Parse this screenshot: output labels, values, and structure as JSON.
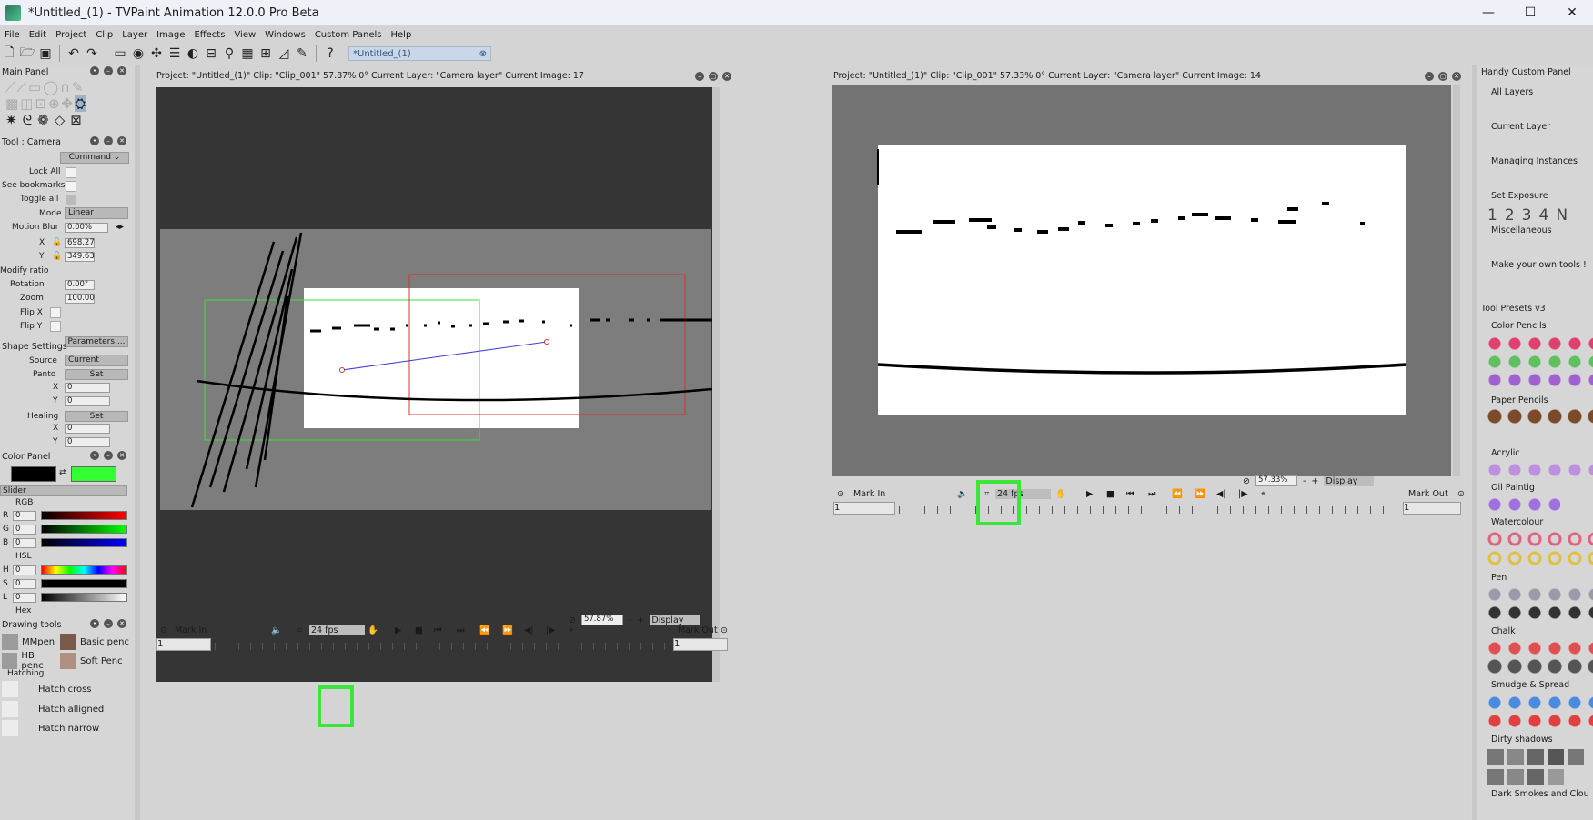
{
  "window": {
    "title": "*Untitled_(1) - TVPaint Animation 12.0.0 Pro Beta",
    "minimize": "—",
    "maximize": "☐",
    "close": "✕"
  },
  "menu": [
    "File",
    "Edit",
    "Project",
    "Clip",
    "Layer",
    "Image",
    "Effects",
    "View",
    "Windows",
    "Custom Panels",
    "Help"
  ],
  "doc_tab": {
    "label": "*Untitled_(1)",
    "close": "⊗"
  },
  "left": {
    "main_panel": "Main Panel",
    "tool_panel": "Tool : Camera",
    "command_label": "Command",
    "lock_all": "Lock All",
    "see_bookmarks": "See bookmarks",
    "toggle_all": "Toggle all",
    "mode_label": "Mode",
    "mode_value": "Linear",
    "motion_blur_label": "Motion Blur",
    "motion_blur_value": "0.00%",
    "x_label": "X",
    "x_value": "698.27",
    "y_label": "Y",
    "y_value": "349.63",
    "modify_ratio": "Modify ratio",
    "rotation_label": "Rotation",
    "rotation_value": "0.00°",
    "zoom_label": "Zoom",
    "zoom_value": "100.00",
    "flip_x": "Flip X",
    "flip_y": "Flip Y",
    "parameters": "Parameters ...",
    "shape_settings": "Shape Settings",
    "source_label": "Source",
    "source_value": "Current",
    "panto_label": "Panto",
    "set_label": "Set",
    "sx_label": "X",
    "sx_value": "0",
    "sy_label": "Y",
    "sy_value": "0",
    "healing_label": "Healing",
    "hx_label": "X",
    "hx_value": "0",
    "hy_label": "Y",
    "hy_value": "0",
    "color_panel": "Color Panel",
    "slider_label": "Slider",
    "rgb_label": "RGB",
    "r_label": "R",
    "r_value": "0",
    "g_label": "G",
    "g_value": "0",
    "b_label": "B",
    "b_value": "0",
    "hsl_label": "HSL",
    "h_label": "H",
    "h_value": "0",
    "s_label": "S",
    "s_value": "0",
    "l_label": "L",
    "l_value": "0",
    "hex_label": "Hex",
    "drawing_tools": "Drawing tools",
    "tools": [
      "MMpen",
      "Basic penc",
      "HB penc",
      "Soft Penc"
    ],
    "hatching": "Hatching",
    "hatch_items": [
      "Hatch cross",
      "Hatch alligned",
      "Hatch narrow"
    ],
    "colors": {
      "primary": "#000000",
      "secondary": "#33ff33"
    }
  },
  "viewer1": {
    "info": "Project:  \"Untitled_(1)\"  Clip: \"Clip_001\"  57.87%  0°  Current Layer: \"Camera layer\"  Current Image: 17",
    "zoom": "57.87%",
    "display": "Display",
    "mark_in": "Mark In",
    "mark_out": "Mark Out",
    "fps": "24 fps",
    "frame_start": "1",
    "frame_end": "1"
  },
  "viewer2": {
    "info": "Project:  \"Untitled_(1)\"  Clip: \"Clip_001\"  57.33%  0°  Current Layer: \"Camera layer\"  Current Image: 14",
    "zoom": "57.33%",
    "display": "Display",
    "mark_in": "Mark In",
    "mark_out": "Mark Out",
    "fps": "24 fps",
    "frame_start": "1",
    "frame_end": "1"
  },
  "right": {
    "handy_title": "Handy Custom Panel",
    "all_layers": "All Layers",
    "current_layer": "Current Layer",
    "managing_instances": "Managing Instances",
    "set_exposure": "Set Exposure",
    "exposure_items": [
      "1",
      "2",
      "3",
      "4",
      "N"
    ],
    "misc": "Miscellaneous",
    "make_own": "Make your own tools !",
    "presets_title": "Tool Presets v3",
    "color_pencils": "Color Pencils",
    "paper_pencils": "Paper Pencils",
    "acrylic": "Acrylic",
    "oil": "Oil Paintig",
    "watercolour": "Watercolour",
    "pen": "Pen",
    "chalk": "Chalk",
    "smudge": "Smudge & Spread",
    "dirty": "Dirty shadows",
    "dark_smokes": "Dark Smokes and Clou"
  }
}
